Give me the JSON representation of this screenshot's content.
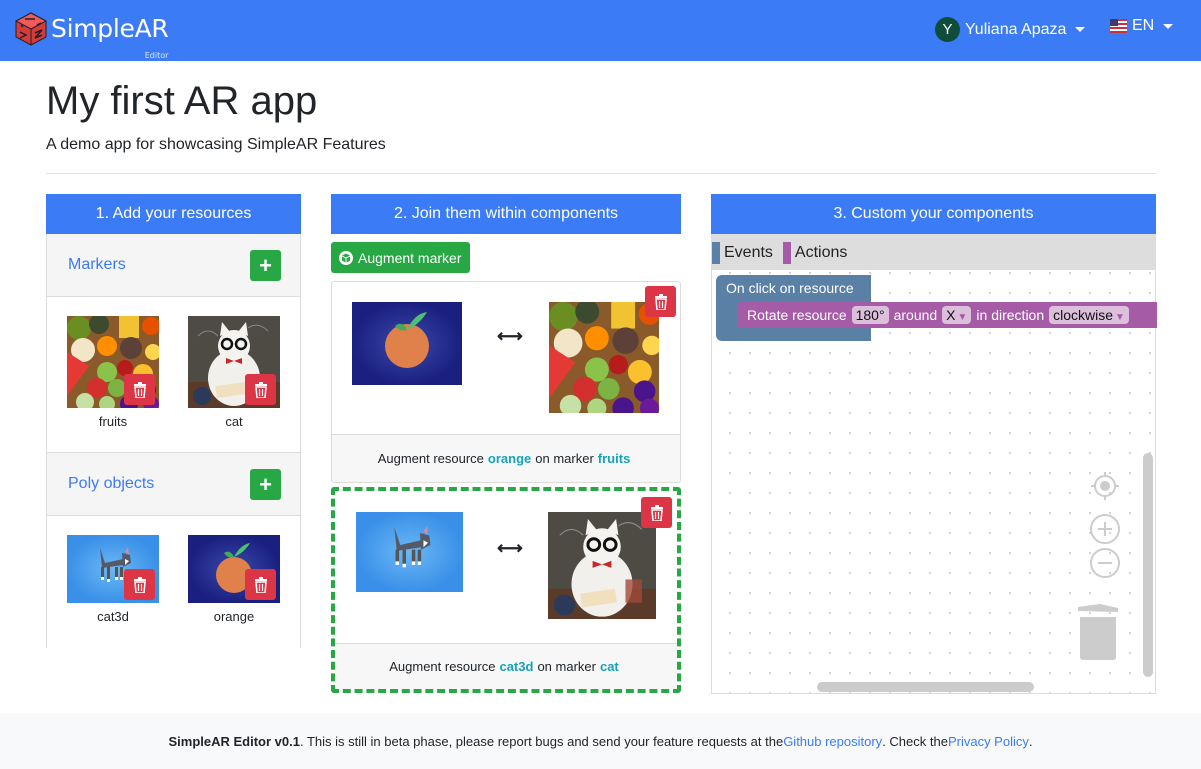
{
  "navbar": {
    "brand": "SimpleAR",
    "brand_sub": "Editor",
    "user_initial": "Y",
    "user_name": "Yuliana Apaza",
    "language": "EN"
  },
  "page": {
    "title": "My first AR app",
    "subtitle": "A demo app for showcasing SimpleAR Features"
  },
  "step1": {
    "header": "1. Add your resources",
    "markers": {
      "title": "Markers",
      "add_label": "+",
      "items": [
        {
          "label": "fruits"
        },
        {
          "label": "cat"
        }
      ]
    },
    "poly": {
      "title": "Poly objects",
      "add_label": "+",
      "items": [
        {
          "label": "cat3d"
        },
        {
          "label": "orange"
        }
      ]
    }
  },
  "step2": {
    "header": "2. Join them within components",
    "augment_button": "Augment marker",
    "components": [
      {
        "prefix": "Augment resource",
        "resource": "orange",
        "middle": "on marker",
        "marker": "fruits",
        "arrow": "⟷"
      },
      {
        "prefix": "Augment resource",
        "resource": "cat3d",
        "middle": "on marker",
        "marker": "cat",
        "arrow": "⟷"
      }
    ]
  },
  "step3": {
    "header": "3. Custom your components",
    "toolbox": [
      {
        "label": "Events",
        "color": "#5b80a5"
      },
      {
        "label": "Actions",
        "color": "#a55ba5"
      }
    ],
    "event_block": "On click on resource",
    "action_block": {
      "text1": "Rotate resource",
      "angle": "180°",
      "text2": "around",
      "axis": "X",
      "text3": "in direction",
      "direction": "clockwise",
      "dropdown": "▼"
    }
  },
  "footer": {
    "app": "SimpleAR Editor v0.1",
    "text1": ". This is still in beta phase, please report bugs and send your feature requests at the ",
    "link1": "Github repository",
    "text2": ". Check the ",
    "link2": "Privacy Policy",
    "text3": "."
  },
  "colors": {
    "primary": "#3b7bf6",
    "success": "#28a745",
    "danger": "#dc3545",
    "info": "#17a2b8"
  }
}
